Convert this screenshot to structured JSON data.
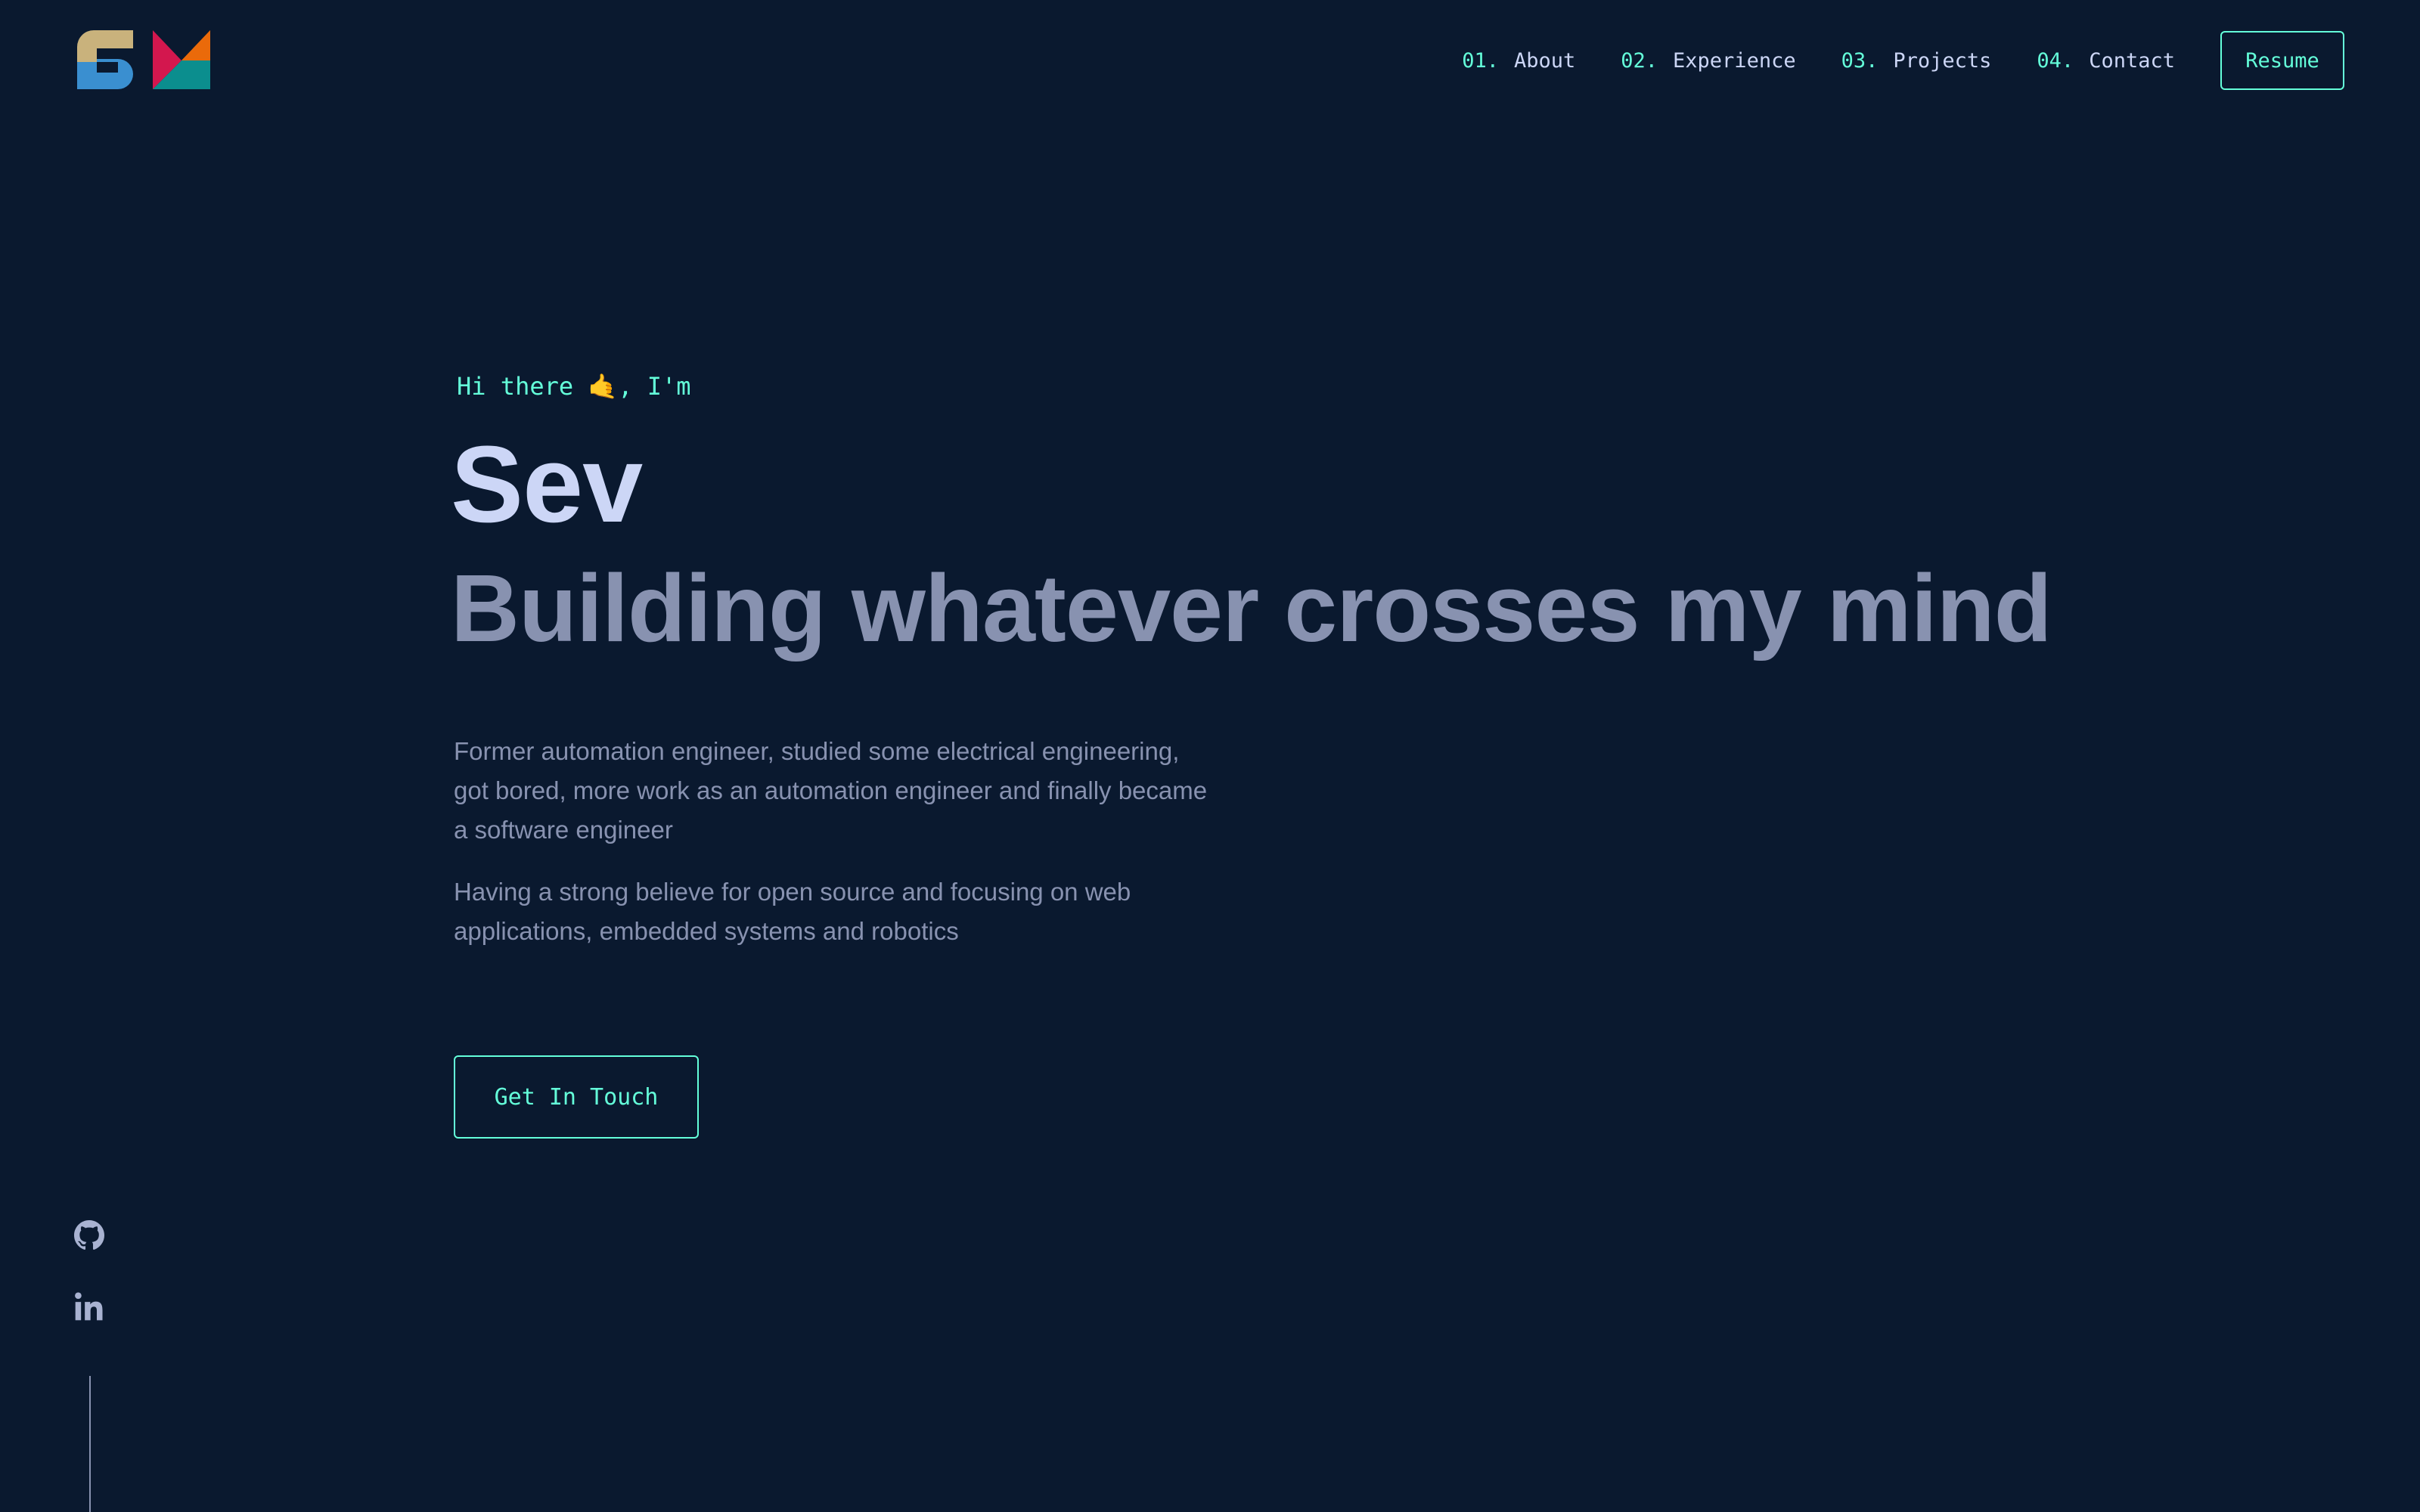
{
  "header": {
    "logo_name": "site-logo",
    "nav": [
      {
        "number": "01.",
        "label": "About"
      },
      {
        "number": "02.",
        "label": "Experience"
      },
      {
        "number": "03.",
        "label": "Projects"
      },
      {
        "number": "04.",
        "label": "Contact"
      }
    ],
    "resume_label": "Resume"
  },
  "hero": {
    "greeting_prefix": "Hi there",
    "greeting_emoji": "🤙",
    "greeting_suffix": ", I'm",
    "name": "Sev",
    "tagline": "Building whatever crosses my mind",
    "bio": [
      "Former automation engineer, studied some electrical engineering, got bored, more work as an automation engineer and finally became a software engineer",
      "Having a strong believe for open source and focusing on web applications, embedded systems and robotics"
    ],
    "cta_label": "Get In Touch"
  },
  "social": [
    {
      "icon": "github-icon"
    },
    {
      "icon": "linkedin-icon"
    }
  ],
  "colors": {
    "background": "#0a192f",
    "accent": "#64ffda",
    "heading": "#ccd6f6",
    "muted": "#8892b0"
  }
}
